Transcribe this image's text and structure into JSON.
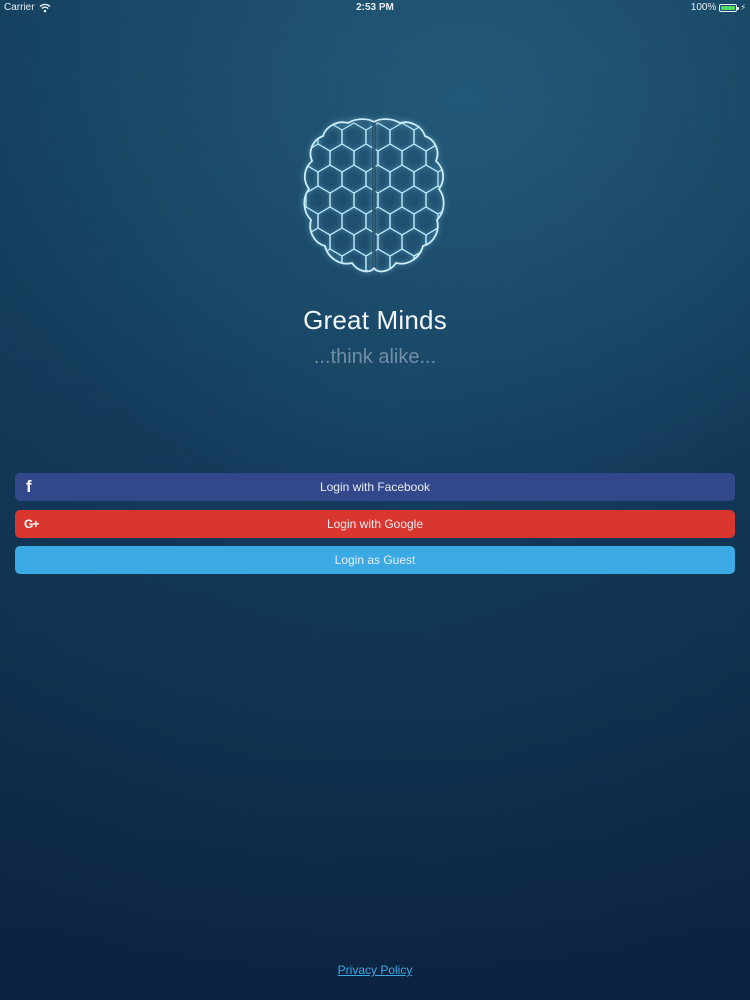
{
  "status_bar": {
    "carrier": "Carrier",
    "time": "2:53 PM",
    "battery": "100%",
    "battery_level": 1.0,
    "battery_color": "#4cd964"
  },
  "app": {
    "title": "Great Minds",
    "tagline": "...think alike...",
    "logo_icon": "brain-hexagon-icon"
  },
  "buttons": {
    "facebook": {
      "label": "Login with Facebook",
      "icon": "facebook-icon",
      "icon_glyph": "f",
      "color": "#33488b"
    },
    "google": {
      "label": "Login with Google",
      "icon": "google-plus-icon",
      "icon_glyph": "G+",
      "color": "#d8362e"
    },
    "guest": {
      "label": "Login as Guest",
      "color": "#3aa9e4"
    }
  },
  "footer": {
    "privacy_label": "Privacy Policy"
  }
}
